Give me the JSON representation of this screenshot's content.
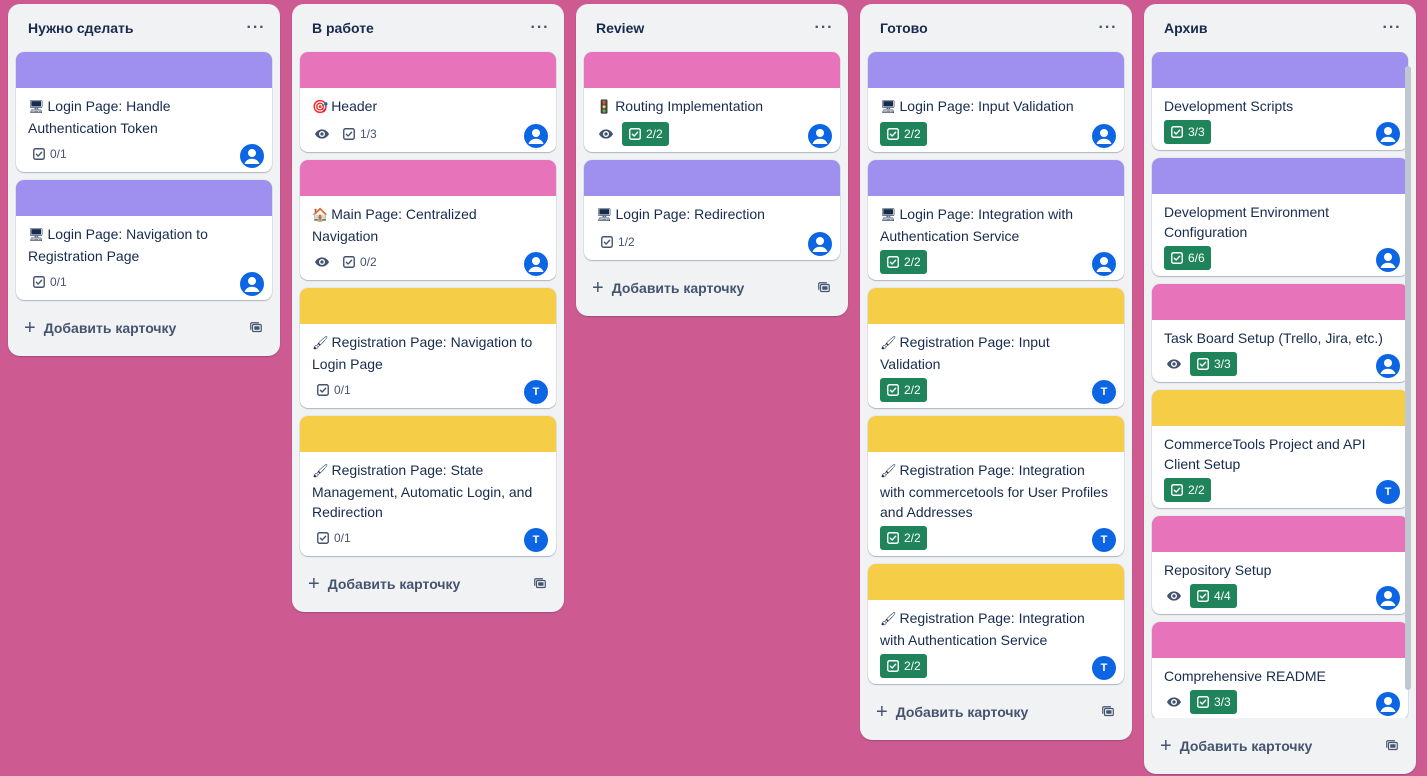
{
  "colors": {
    "purple": "#9f8fef",
    "pink": "#e774bb",
    "yellow": "#f5cd47",
    "green_badge": "#1f845a",
    "avatar_blue": "#0c66e4",
    "board_bg": "#cd5a91"
  },
  "lists": [
    {
      "title": "Нужно сделать",
      "menu": "···",
      "add_label": "Добавить карточку",
      "cards": [
        {
          "cover": "purple",
          "emoji": "🖥",
          "title": "Login Page: Handle Authentication Token",
          "watch": false,
          "checklist": "0/1",
          "done": false,
          "avatar": "user-icon"
        },
        {
          "cover": "purple",
          "emoji": "🖥",
          "title": "Login Page: Navigation to Registration Page",
          "watch": false,
          "checklist": "0/1",
          "done": false,
          "avatar": "user-icon"
        }
      ]
    },
    {
      "title": "В работе",
      "menu": "···",
      "add_label": "Добавить карточку",
      "cards": [
        {
          "cover": "pink",
          "emoji": "🎯",
          "title": "Header",
          "watch": true,
          "checklist": "1/3",
          "done": false,
          "avatar": "user-icon"
        },
        {
          "cover": "pink",
          "emoji": "🏠",
          "title": "Main Page: Centralized Navigation",
          "watch": true,
          "checklist": "0/2",
          "done": false,
          "avatar": "user-icon"
        },
        {
          "cover": "yellow",
          "emoji": "🖌",
          "title": "Registration Page: Navigation to Login Page",
          "watch": false,
          "checklist": "0/1",
          "done": false,
          "avatar": "T"
        },
        {
          "cover": "yellow",
          "emoji": "🖌",
          "title": "Registration Page: State Management, Automatic Login, and Redirection",
          "watch": false,
          "checklist": "0/1",
          "done": false,
          "avatar": "T"
        }
      ]
    },
    {
      "title": "Review",
      "menu": "···",
      "add_label": "Добавить карточку",
      "cards": [
        {
          "cover": "pink",
          "emoji": "🚦",
          "title": "Routing Implementation",
          "watch": true,
          "checklist": "2/2",
          "done": true,
          "avatar": "user-icon"
        },
        {
          "cover": "purple",
          "emoji": "🖥",
          "title": "Login Page: Redirection",
          "watch": false,
          "checklist": "1/2",
          "done": false,
          "avatar": "user-icon"
        }
      ]
    },
    {
      "title": "Готово",
      "menu": "···",
      "add_label": "Добавить карточку",
      "cards": [
        {
          "cover": "purple",
          "emoji": "🖥",
          "title": "Login Page: Input Validation",
          "watch": false,
          "checklist": "2/2",
          "done": true,
          "avatar": "user-icon"
        },
        {
          "cover": "purple",
          "emoji": "🖥",
          "title": "Login Page: Integration with Authentication Service",
          "watch": false,
          "checklist": "2/2",
          "done": true,
          "avatar": "user-icon"
        },
        {
          "cover": "yellow",
          "emoji": "🖌",
          "title": "Registration Page: Input Validation",
          "watch": false,
          "checklist": "2/2",
          "done": true,
          "avatar": "T"
        },
        {
          "cover": "yellow",
          "emoji": "🖌",
          "title": "Registration Page: Integration with commercetools for User Profiles and Addresses",
          "watch": false,
          "checklist": "2/2",
          "done": true,
          "avatar": "T"
        },
        {
          "cover": "yellow",
          "emoji": "🖌",
          "title": "Registration Page: Integration with Authentication Service",
          "watch": false,
          "checklist": "2/2",
          "done": true,
          "avatar": "T"
        }
      ]
    },
    {
      "title": "Архив",
      "menu": "···",
      "add_label": "Добавить карточку",
      "cards": [
        {
          "cover": "purple",
          "emoji": "",
          "title": "Development Scripts",
          "watch": false,
          "checklist": "3/3",
          "done": true,
          "avatar": "user-icon"
        },
        {
          "cover": "purple",
          "emoji": "",
          "title": "Development Environment Configuration",
          "watch": false,
          "checklist": "6/6",
          "done": true,
          "avatar": "user-icon"
        },
        {
          "cover": "pink",
          "emoji": "",
          "title": "Task Board Setup (Trello, Jira, etc.)",
          "watch": true,
          "checklist": "3/3",
          "done": true,
          "avatar": "user-icon"
        },
        {
          "cover": "yellow",
          "emoji": "",
          "title": "CommerceTools Project and API Client Setup",
          "watch": false,
          "checklist": "2/2",
          "done": true,
          "avatar": "T"
        },
        {
          "cover": "pink",
          "emoji": "",
          "title": "Repository Setup",
          "watch": true,
          "checklist": "4/4",
          "done": true,
          "avatar": "user-icon"
        },
        {
          "cover": "pink",
          "emoji": "",
          "title": "Comprehensive README",
          "watch": true,
          "checklist": "3/3",
          "done": true,
          "avatar": "user-icon"
        }
      ]
    }
  ]
}
